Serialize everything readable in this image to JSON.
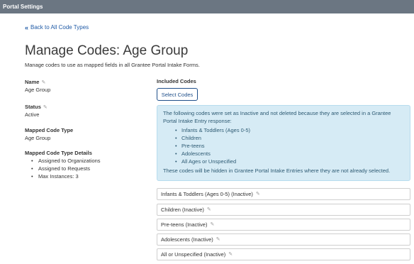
{
  "topbar": {
    "title": "Portal Settings"
  },
  "back_link": {
    "label": "Back to All Code Types"
  },
  "page": {
    "title": "Manage Codes: Age Group",
    "subtitle": "Manage codes to use as mapped fields in all Grantee Portal Intake Forms."
  },
  "fields": {
    "name": {
      "label": "Name",
      "value": "Age Group"
    },
    "status": {
      "label": "Status",
      "value": "Active"
    },
    "mapped_code_type": {
      "label": "Mapped Code Type",
      "value": "Age Group"
    },
    "mapped_details": {
      "label": "Mapped Code Type Details",
      "items": [
        "Assigned to Organizations",
        "Assigned to Requests",
        "Max Instances: 3"
      ]
    }
  },
  "included": {
    "label": "Included Codes",
    "select_button": "Select Codes",
    "alert": {
      "intro": "The following codes were set as Inactive and not deleted because they are selected in a Grantee Portal Intake Entry response:",
      "items": [
        "Infants & Toddlers (Ages 0-5)",
        "Children",
        "Pre-teens",
        "Adolescents",
        "All Ages or Unspecified"
      ],
      "footer": "These codes will be hidden in Grantee Portal Intake Entries where they are not already selected."
    },
    "codes": [
      "Infants & Toddlers (Ages 0-5) (Inactive)",
      "Children (Inactive)",
      "Pre-teens (Inactive)",
      "Adolescents (Inactive)",
      "All or Unspecified (Inactive)"
    ]
  },
  "icons": {
    "edit": "pencil-icon",
    "back": "double-chevron-left-icon"
  },
  "colors": {
    "topbar": "#6b7682",
    "link": "#1f5aa6",
    "alert_bg": "#d6ebf5",
    "alert_text": "#2d5a73"
  }
}
